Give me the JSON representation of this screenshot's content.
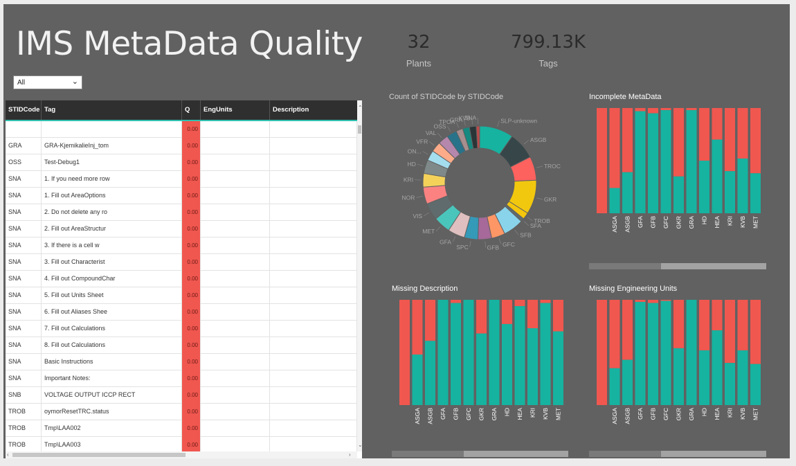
{
  "header": {
    "title": "IMS MetaData Quality"
  },
  "kpis": [
    {
      "value": "32",
      "label": "Plants"
    },
    {
      "value": "799.13K",
      "label": "Tags"
    }
  ],
  "filter": {
    "selected": "All"
  },
  "table": {
    "columns": [
      "STIDCode",
      "Tag",
      "Q",
      "EngUnits",
      "Description"
    ],
    "rows": [
      [
        "",
        "",
        "0.00",
        "",
        ""
      ],
      [
        "GRA",
        "GRA-KjemikalieInj_tom",
        "0.00",
        "",
        ""
      ],
      [
        "OSS",
        "Test-Debug1",
        "0.00",
        "",
        ""
      ],
      [
        "SNA",
        "1. If you need more row",
        "0.00",
        "",
        ""
      ],
      [
        "SNA",
        "1. Fill out AreaOptions",
        "0.00",
        "",
        ""
      ],
      [
        "SNA",
        "2. Do not delete any ro",
        "0.00",
        "",
        ""
      ],
      [
        "SNA",
        "2. Fill out AreaStructur",
        "0.00",
        "",
        ""
      ],
      [
        "SNA",
        "3. If there is a cell w",
        "0.00",
        "",
        ""
      ],
      [
        "SNA",
        "3. Fill out Characterist",
        "0.00",
        "",
        ""
      ],
      [
        "SNA",
        "4. Fill out CompoundChar",
        "0.00",
        "",
        ""
      ],
      [
        "SNA",
        "5. Fill out Units Sheet",
        "0.00",
        "",
        ""
      ],
      [
        "SNA",
        "6. Fill out Aliases Shee",
        "0.00",
        "",
        ""
      ],
      [
        "SNA",
        "7. Fill out Calculations",
        "0.00",
        "",
        ""
      ],
      [
        "SNA",
        "8. Fill out Calculations",
        "0.00",
        "",
        ""
      ],
      [
        "SNA",
        "Basic Instructions",
        "0.00",
        "",
        ""
      ],
      [
        "SNA",
        "Important Notes:",
        "0.00",
        "",
        ""
      ],
      [
        "SNB",
        "VOLTAGE OUTPUT ICCP RECT",
        "0.00",
        "",
        ""
      ],
      [
        "TROB",
        "oymorResetTRC.status",
        "0.00",
        "",
        ""
      ],
      [
        "TROB",
        "Tmp\\LAA002",
        "0.00",
        "",
        ""
      ],
      [
        "TROB",
        "Tmp\\LAA003",
        "0.00",
        "",
        ""
      ]
    ]
  },
  "colors": {
    "complete": "#16b3a0",
    "missing": "#f0574f",
    "panel": "#616161"
  },
  "chart_data": [
    {
      "type": "pie",
      "title": "Count of STIDCode by STIDCode",
      "donut": true,
      "labels": [
        "SLP-unknown",
        "ASGB",
        "TROC",
        "GKR",
        "TROB",
        "SFA",
        "SFB",
        "GFC",
        "GFB",
        "SPC",
        "GFA",
        "MET",
        "VIS",
        "NOR",
        "KRI",
        "HD",
        "ON...",
        "VFR",
        "VAL",
        "OSS",
        "TPOA",
        "GRA",
        "KVB",
        "SNA"
      ],
      "values": [
        10,
        8,
        7,
        10,
        2,
        1,
        6,
        4,
        4,
        4,
        5,
        5,
        5,
        5,
        4,
        4,
        3,
        3,
        3,
        3,
        2,
        2,
        2,
        1
      ],
      "colors": [
        "#16b3a0",
        "#374649",
        "#fd625e",
        "#f2c80f",
        "#f4c60c",
        "#5f6b6d",
        "#8ad4eb",
        "#fe9666",
        "#a66999",
        "#3599b8",
        "#dfbfbf",
        "#4ac5bb",
        "#5f6b6d",
        "#fb8281",
        "#f4d25a",
        "#7f898a",
        "#a4ddee",
        "#fdab89",
        "#b687ac",
        "#28738a",
        "#a78f8f",
        "#168980",
        "#293537",
        "#bb4a4a"
      ]
    },
    {
      "type": "bar",
      "stacked": true,
      "title": "Incomplete MetaData",
      "categories": [
        "",
        "ASGA",
        "ASGB",
        "GFA",
        "GFB",
        "GFC",
        "GKR",
        "GRA",
        "HD",
        "HEA",
        "KRI",
        "KVB",
        "MET"
      ],
      "series": [
        {
          "values": [
            0,
            24,
            39,
            97,
            95,
            98,
            35,
            98,
            50,
            70,
            40,
            52,
            38
          ]
        },
        {
          "values": [
            100,
            76,
            61,
            3,
            5,
            2,
            65,
            2,
            50,
            30,
            60,
            48,
            62
          ]
        }
      ],
      "ylim": [
        0,
        100
      ]
    },
    {
      "type": "bar",
      "stacked": true,
      "title": "Missing Description",
      "categories": [
        "",
        "ASGA",
        "ASGB",
        "GFA",
        "GFB",
        "GFC",
        "GKR",
        "GRA",
        "HD",
        "HEA",
        "KRI",
        "KVB",
        "MET"
      ],
      "series": [
        {
          "values": [
            0,
            48,
            61,
            100,
            97,
            100,
            68,
            100,
            77,
            94,
            73,
            97,
            70
          ]
        },
        {
          "values": [
            100,
            52,
            39,
            0,
            3,
            0,
            32,
            0,
            23,
            6,
            27,
            3,
            30
          ]
        }
      ],
      "ylim": [
        0,
        100
      ]
    },
    {
      "type": "bar",
      "stacked": true,
      "title": "Missing Engineering Units",
      "categories": [
        "",
        "ASGA",
        "ASGB",
        "GFA",
        "GFB",
        "GFC",
        "GKR",
        "GRA",
        "HD",
        "HEA",
        "KRI",
        "KVB",
        "MET"
      ],
      "series": [
        {
          "values": [
            0,
            35,
            43,
            98,
            97,
            99,
            54,
            100,
            52,
            71,
            40,
            52,
            39
          ]
        },
        {
          "values": [
            100,
            65,
            57,
            2,
            3,
            1,
            46,
            0,
            48,
            29,
            60,
            48,
            61
          ]
        }
      ],
      "ylim": [
        0,
        100
      ]
    }
  ]
}
